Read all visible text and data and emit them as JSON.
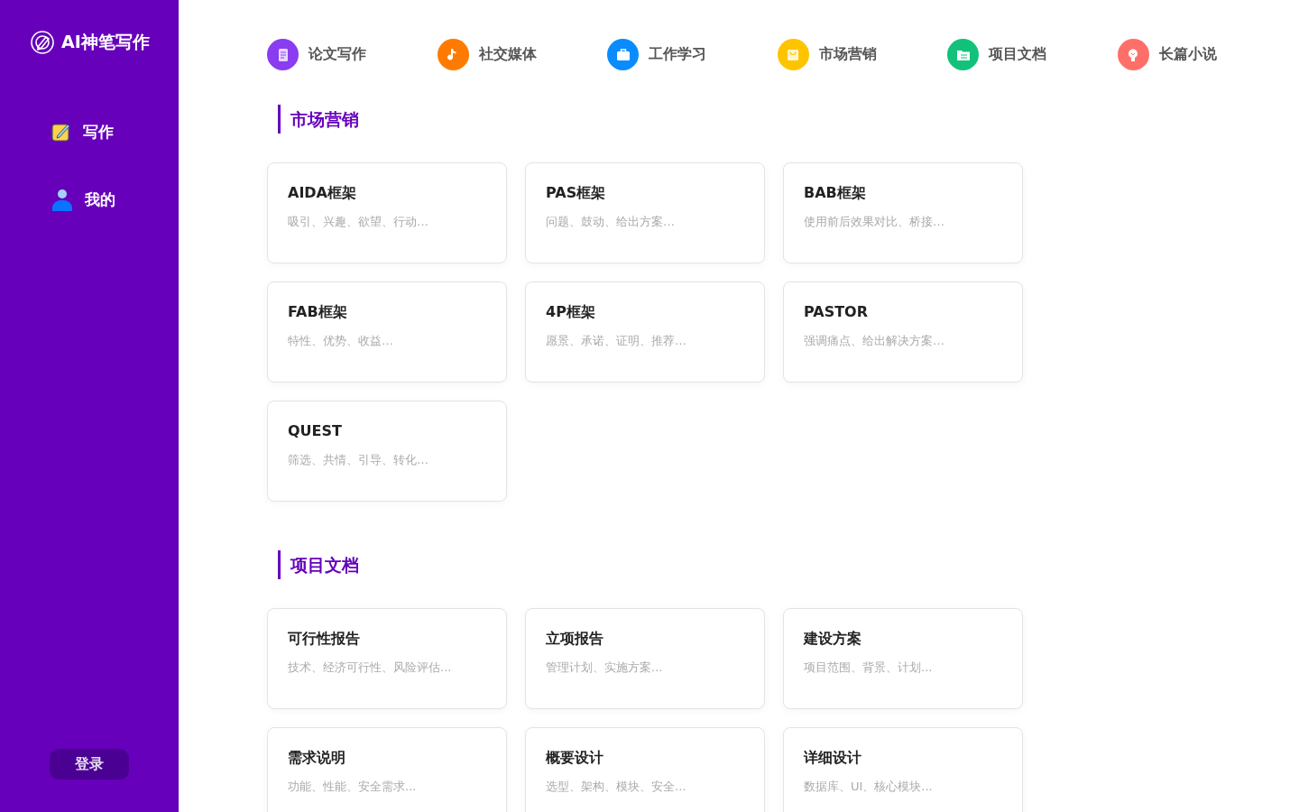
{
  "sidebar": {
    "logo": "AI神笔写作",
    "items": [
      {
        "label": "写作",
        "kind": "write"
      },
      {
        "label": "我的",
        "kind": "user"
      }
    ],
    "login_button": "登录"
  },
  "categories": [
    {
      "label": "论文写作",
      "kind": "paper",
      "color": "#8a3cf0"
    },
    {
      "label": "社交媒体",
      "kind": "music",
      "color": "#ff7a00"
    },
    {
      "label": "工作学习",
      "kind": "briefcase",
      "color": "#0a8cff"
    },
    {
      "label": "市场营销",
      "kind": "bag",
      "color": "#ffc400"
    },
    {
      "label": "项目文档",
      "kind": "folder",
      "color": "#12c27a"
    },
    {
      "label": "长篇小说",
      "kind": "bulb",
      "color": "#ff6f6a"
    }
  ],
  "sections": [
    {
      "title": "市场营销",
      "cards": [
        {
          "title": "AIDA框架",
          "desc": "吸引、兴趣、欲望、行动…"
        },
        {
          "title": "PAS框架",
          "desc": "问题、鼓动、给出方案…"
        },
        {
          "title": "BAB框架",
          "desc": "使用前后效果对比、桥接…"
        },
        {
          "title": "FAB框架",
          "desc": "特性、优势、收益…"
        },
        {
          "title": "4P框架",
          "desc": "愿景、承诺、证明、推荐…"
        },
        {
          "title": "PASTOR",
          "desc": "强调痛点、给出解决方案…"
        },
        {
          "title": "QUEST",
          "desc": "筛选、共情、引导、转化…"
        }
      ]
    },
    {
      "title": "项目文档",
      "cards": [
        {
          "title": "可行性报告",
          "desc": "技术、经济可行性、风险评估..."
        },
        {
          "title": "立项报告",
          "desc": "管理计划、实施方案..."
        },
        {
          "title": "建设方案",
          "desc": "项目范围、背景、计划..."
        },
        {
          "title": "需求说明",
          "desc": "功能、性能、安全需求..."
        },
        {
          "title": "概要设计",
          "desc": "选型、架构、模块、安全..."
        },
        {
          "title": "详细设计",
          "desc": "数据库、UI、核心模块..."
        }
      ]
    }
  ]
}
